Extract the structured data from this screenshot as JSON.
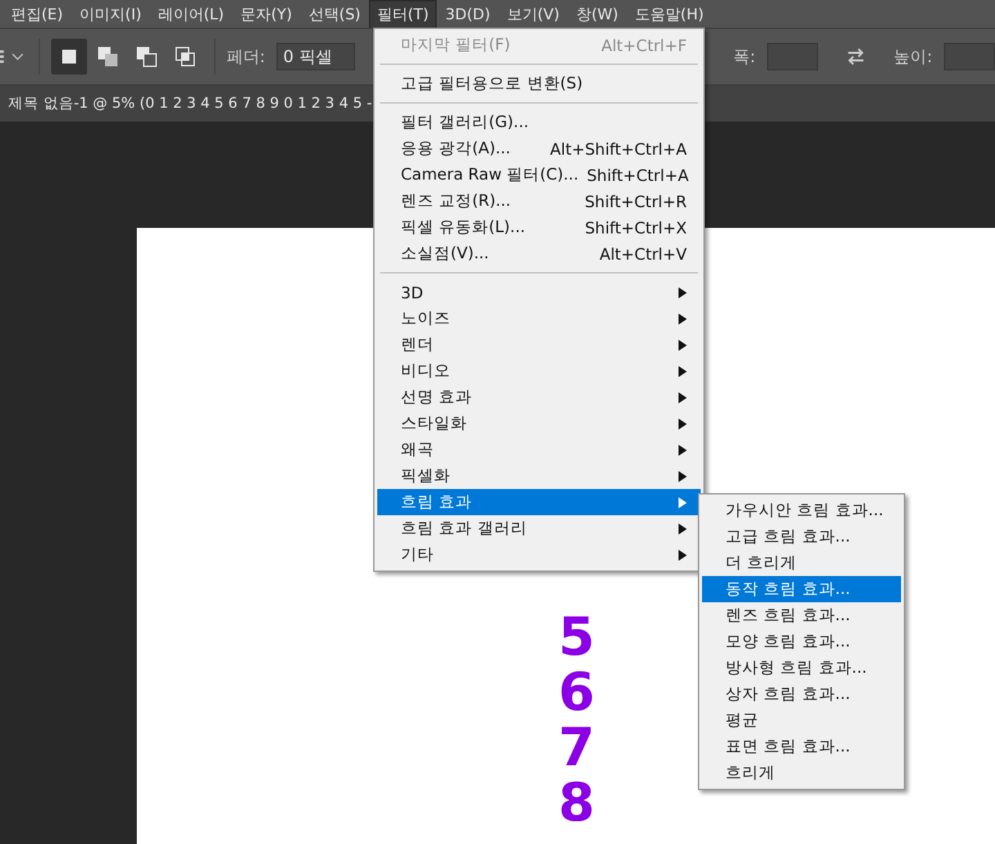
{
  "menubar": [
    {
      "label": "편집(E)",
      "selected": false
    },
    {
      "label": "이미지(I)",
      "selected": false
    },
    {
      "label": "레이어(L)",
      "selected": false
    },
    {
      "label": "문자(Y)",
      "selected": false
    },
    {
      "label": "선택(S)",
      "selected": false
    },
    {
      "label": "필터(T)",
      "selected": true
    },
    {
      "label": "3D(D)",
      "selected": false
    },
    {
      "label": "보기(V)",
      "selected": false
    },
    {
      "label": "창(W)",
      "selected": false
    },
    {
      "label": "도움말(H)",
      "selected": false
    }
  ],
  "options_bar": {
    "modes": [
      {
        "selected": true
      },
      {
        "selected": false
      },
      {
        "selected": false
      },
      {
        "selected": false
      }
    ],
    "feather_label": "페더:",
    "feather_value": "0 픽셀",
    "width_label": "폭:",
    "height_label": "높이:"
  },
  "document_tab": {
    "title": "제목 없음-1 @ 5% (0 1 2 3 4 5 6 7 8 9 0 1 2 3 4 5 -"
  },
  "canvas": {
    "digits": [
      "5",
      "6",
      "7",
      "8"
    ]
  },
  "filter_menu": [
    {
      "kind": "item",
      "label": "마지막 필터(F)",
      "shortcut": "Alt+Ctrl+F",
      "disabled": true,
      "selected": false
    },
    {
      "kind": "separator"
    },
    {
      "kind": "item",
      "label": "고급 필터용으로 변환(S)",
      "disabled": false,
      "selected": false
    },
    {
      "kind": "separator"
    },
    {
      "kind": "item",
      "label": "필터 갤러리(G)...",
      "disabled": false,
      "selected": false
    },
    {
      "kind": "item",
      "label": "응용 광각(A)...",
      "shortcut": "Alt+Shift+Ctrl+A",
      "disabled": false,
      "selected": false
    },
    {
      "kind": "item",
      "label": "Camera Raw 필터(C)...",
      "shortcut": "Shift+Ctrl+A",
      "disabled": false,
      "selected": false
    },
    {
      "kind": "item",
      "label": "렌즈 교정(R)...",
      "shortcut": "Shift+Ctrl+R",
      "disabled": false,
      "selected": false
    },
    {
      "kind": "item",
      "label": "픽셀 유동화(L)...",
      "shortcut": "Shift+Ctrl+X",
      "disabled": false,
      "selected": false
    },
    {
      "kind": "item",
      "label": "소실점(V)...",
      "shortcut": "Alt+Ctrl+V",
      "disabled": false,
      "selected": false
    },
    {
      "kind": "separator"
    },
    {
      "kind": "submenu",
      "label": "3D",
      "disabled": false,
      "selected": false
    },
    {
      "kind": "submenu",
      "label": "노이즈",
      "disabled": false,
      "selected": false
    },
    {
      "kind": "submenu",
      "label": "렌더",
      "disabled": false,
      "selected": false
    },
    {
      "kind": "submenu",
      "label": "비디오",
      "disabled": false,
      "selected": false
    },
    {
      "kind": "submenu",
      "label": "선명 효과",
      "disabled": false,
      "selected": false
    },
    {
      "kind": "submenu",
      "label": "스타일화",
      "disabled": false,
      "selected": false
    },
    {
      "kind": "submenu",
      "label": "왜곡",
      "disabled": false,
      "selected": false
    },
    {
      "kind": "submenu",
      "label": "픽셀화",
      "disabled": false,
      "selected": false
    },
    {
      "kind": "submenu",
      "label": "흐림 효과",
      "disabled": false,
      "selected": true
    },
    {
      "kind": "submenu",
      "label": "흐림 효과 갤러리",
      "disabled": false,
      "selected": false
    },
    {
      "kind": "submenu",
      "label": "기타",
      "disabled": false,
      "selected": false
    }
  ],
  "blur_submenu": [
    {
      "label": "가우시안 흐림 효과...",
      "selected": false
    },
    {
      "label": "고급 흐림 효과...",
      "selected": false
    },
    {
      "label": "더 흐리게",
      "selected": false
    },
    {
      "label": "동작 흐림 효과...",
      "selected": true
    },
    {
      "label": "렌즈 흐림 효과...",
      "selected": false
    },
    {
      "label": "모양 흐림 효과...",
      "selected": false
    },
    {
      "label": "방사형 흐림 효과...",
      "selected": false
    },
    {
      "label": "상자 흐림 효과...",
      "selected": false
    },
    {
      "label": "평균",
      "selected": false
    },
    {
      "label": "표면 흐림 효과...",
      "selected": false
    },
    {
      "label": "흐리게",
      "selected": false
    }
  ]
}
